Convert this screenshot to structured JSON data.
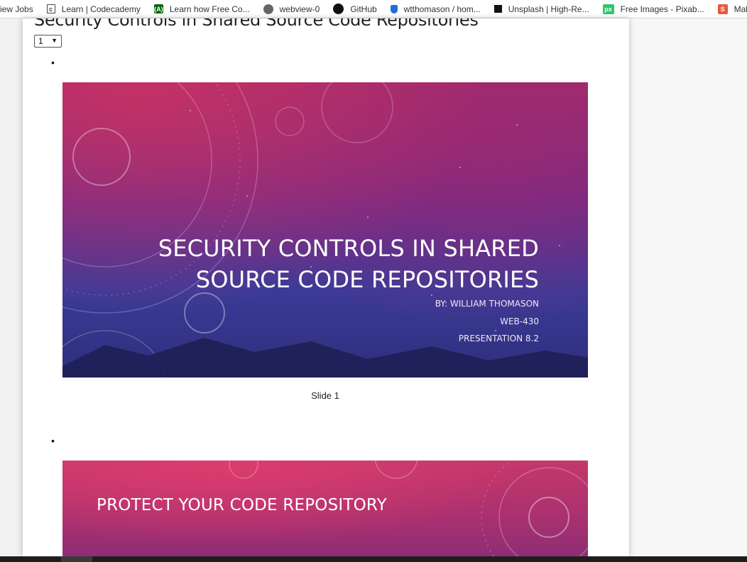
{
  "bookmarks": [
    {
      "label": "iew Jobs",
      "icon": "none"
    },
    {
      "label": "Learn | Codecademy",
      "icon": "codecademy-icon",
      "glyph": "c"
    },
    {
      "label": "Learn how Free Co...",
      "icon": "freecodecamp-icon",
      "glyph": "(A)"
    },
    {
      "label": "webview-0",
      "icon": "globe-icon",
      "glyph": "◉"
    },
    {
      "label": "GitHub",
      "icon": "github-icon",
      "glyph": ""
    },
    {
      "label": "wtthomason / hom...",
      "icon": "bitbucket-icon",
      "glyph": ""
    },
    {
      "label": "Unsplash | High-Re...",
      "icon": "unsplash-icon",
      "glyph": ""
    },
    {
      "label": "Free Images - Pixab...",
      "icon": "pixabay-icon",
      "glyph": "px"
    },
    {
      "label": "Maki",
      "icon": "makeuseof-icon",
      "glyph": "S"
    }
  ],
  "page": {
    "title": "Security Controls in Shared Source Code Repositories",
    "selected_slide": "1",
    "bullet": "•"
  },
  "slides": [
    {
      "title_line1": "SECURITY CONTROLS IN SHARED",
      "title_line2": "SOURCE CODE REPOSITORIES",
      "author": "BY: WILLIAM THOMASON",
      "course": "WEB-430",
      "presentation": "PRESENTATION 8.2",
      "caption": "Slide 1"
    },
    {
      "title": "PROTECT YOUR CODE REPOSITORY"
    }
  ],
  "colors": {
    "slide_magenta": "#a22c6d",
    "slide_indigo": "#3b3b98",
    "slide2_pink": "#c5386a"
  }
}
